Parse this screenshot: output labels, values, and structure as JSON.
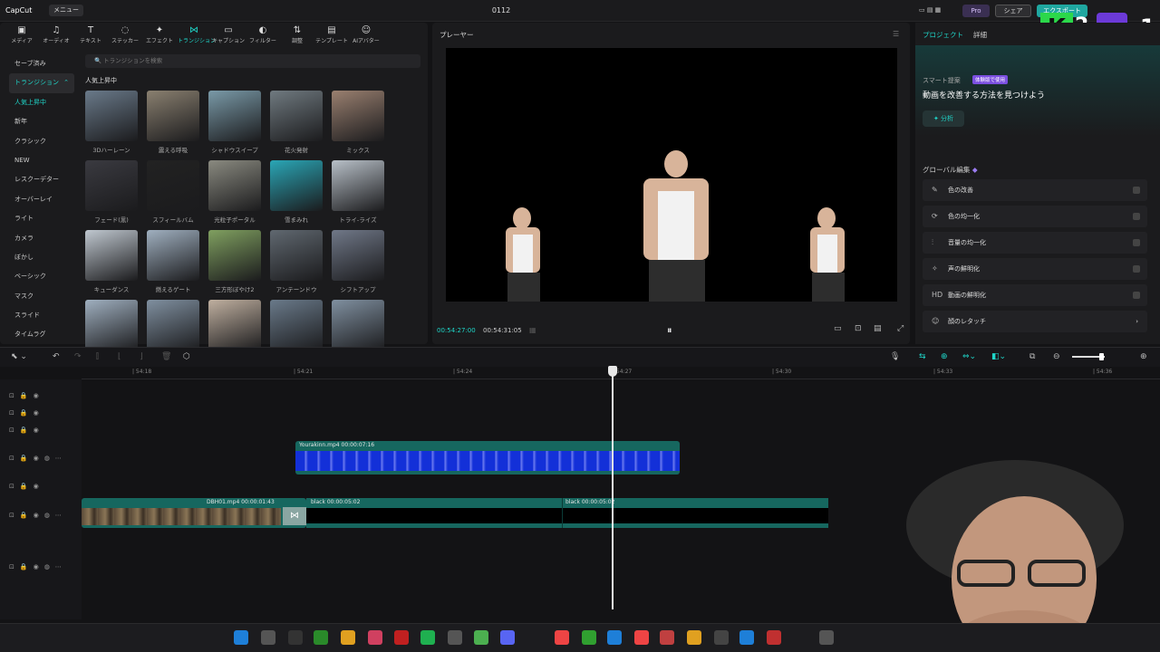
{
  "app": {
    "logo": "CapCut",
    "menu": "メニュー",
    "title": "0112",
    "pro": "Pro",
    "share": "シェア",
    "export": "エクスポート"
  },
  "overlay": {
    "k": "K",
    "two": "2",
    "one": "1"
  },
  "toolbar": [
    "メディア",
    "オーディオ",
    "テキスト",
    "ステッカー",
    "エフェクト",
    "トランジション",
    "キャプション",
    "フィルター",
    "調整",
    "テンプレート",
    "AIアバター"
  ],
  "toolbar_icons": [
    "media-icon",
    "audio-icon",
    "text-icon",
    "sticker-icon",
    "effect-icon",
    "transition-icon",
    "caption-icon",
    "filter-icon",
    "adjust-icon",
    "template-icon",
    "avatar-icon"
  ],
  "categories": [
    "セーブ済み",
    "トランジション",
    "人気上昇中",
    "新年",
    "クラシック",
    "NEW",
    "レスクーデター",
    "オーバーレイ",
    "ライト",
    "カメラ",
    "ぼかし",
    "ベーシック",
    "マスク",
    "スライド",
    "タイムラグ"
  ],
  "search_placeholder": "トランジションを検索",
  "section_title": "人気上昇中",
  "tiles": [
    "3Dハーレーン",
    "震える呼吸",
    "シャドウスイープ",
    "花火発射",
    "ミックス",
    "フェード(黒)",
    "スフィールバム",
    "光粒子ポータル",
    "雪まみれ",
    "トライ-ライズ",
    "キューダンス",
    "燃えるゲート",
    "三方形ぼやけ2",
    "アンテーンドウ",
    "シフトアップ",
    "",
    "",
    "",
    "",
    ""
  ],
  "player": {
    "title": "プレーヤー",
    "current": "00:54:27:00",
    "total": "00:54:31:05"
  },
  "right": {
    "tab_project": "プロジェクト",
    "tab_detail": "詳細",
    "smart_label": "スマート提案",
    "smart_badge": "体験版で使用",
    "smart_title": "動画を改善する方法を見つけよう",
    "analyze": "分析",
    "global": "グローバル編集"
  },
  "options": [
    "色の改善",
    "色の均一化",
    "音量の均一化",
    "声の鮮明化",
    "動画の鮮明化",
    "顔のレタッチ"
  ],
  "option_icons": [
    "color-icon",
    "balance-icon",
    "volume-icon",
    "voice-icon",
    "hd-icon",
    "face-icon"
  ],
  "option_hd": "HD",
  "ruler": [
    "| 54:18",
    "| 54:21",
    "| 54:24",
    "| 54:27",
    "| 54:30",
    "| 54:33",
    "| 54:36"
  ],
  "clips": {
    "overlay": "Yourakinn.mp4  00:00:07:16",
    "main": "DBH01.mp4  00:00:01:43",
    "black1": "black  00:00:05:02",
    "black2": "black  00:00:05:02"
  }
}
